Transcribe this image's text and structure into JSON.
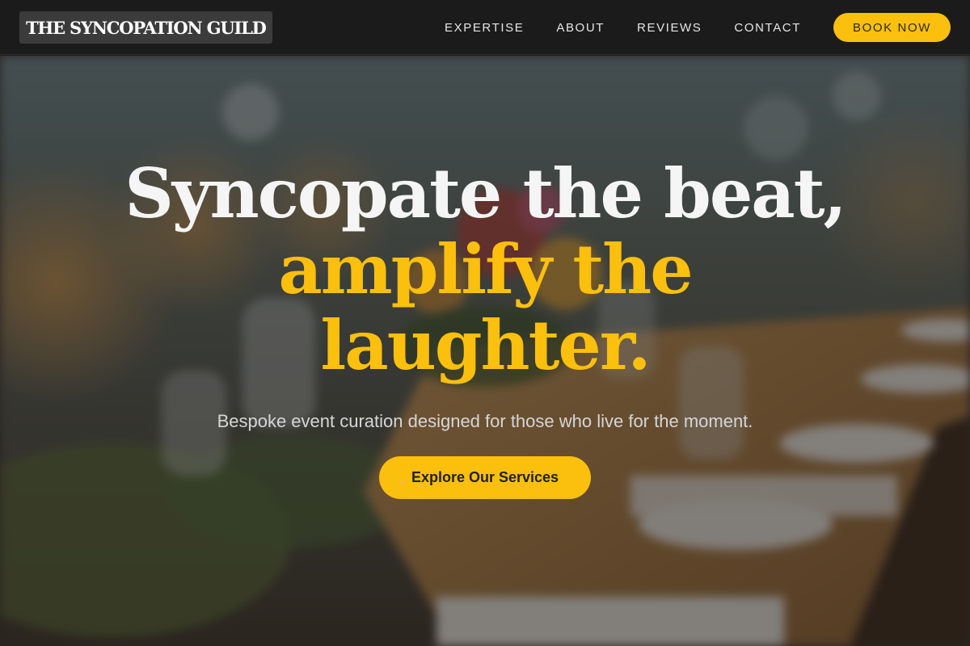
{
  "brand": {
    "logo_text": "THE SYNCOPATION GUILD"
  },
  "nav": {
    "links": [
      {
        "label": "EXPERTISE"
      },
      {
        "label": "ABOUT"
      },
      {
        "label": "REVIEWS"
      },
      {
        "label": "CONTACT"
      }
    ],
    "book_label": "BOOK NOW"
  },
  "hero": {
    "headline_line1": "Syncopate the beat,",
    "headline_line2": "amplify the",
    "headline_line3": "laughter.",
    "subtitle": "Bespoke event curation designed for those who live for the moment.",
    "cta_label": "Explore Our Services"
  },
  "colors": {
    "accent": "#fbbf0d",
    "navbar": "#1b1b1b",
    "headline_white": "#f5f5f5"
  }
}
